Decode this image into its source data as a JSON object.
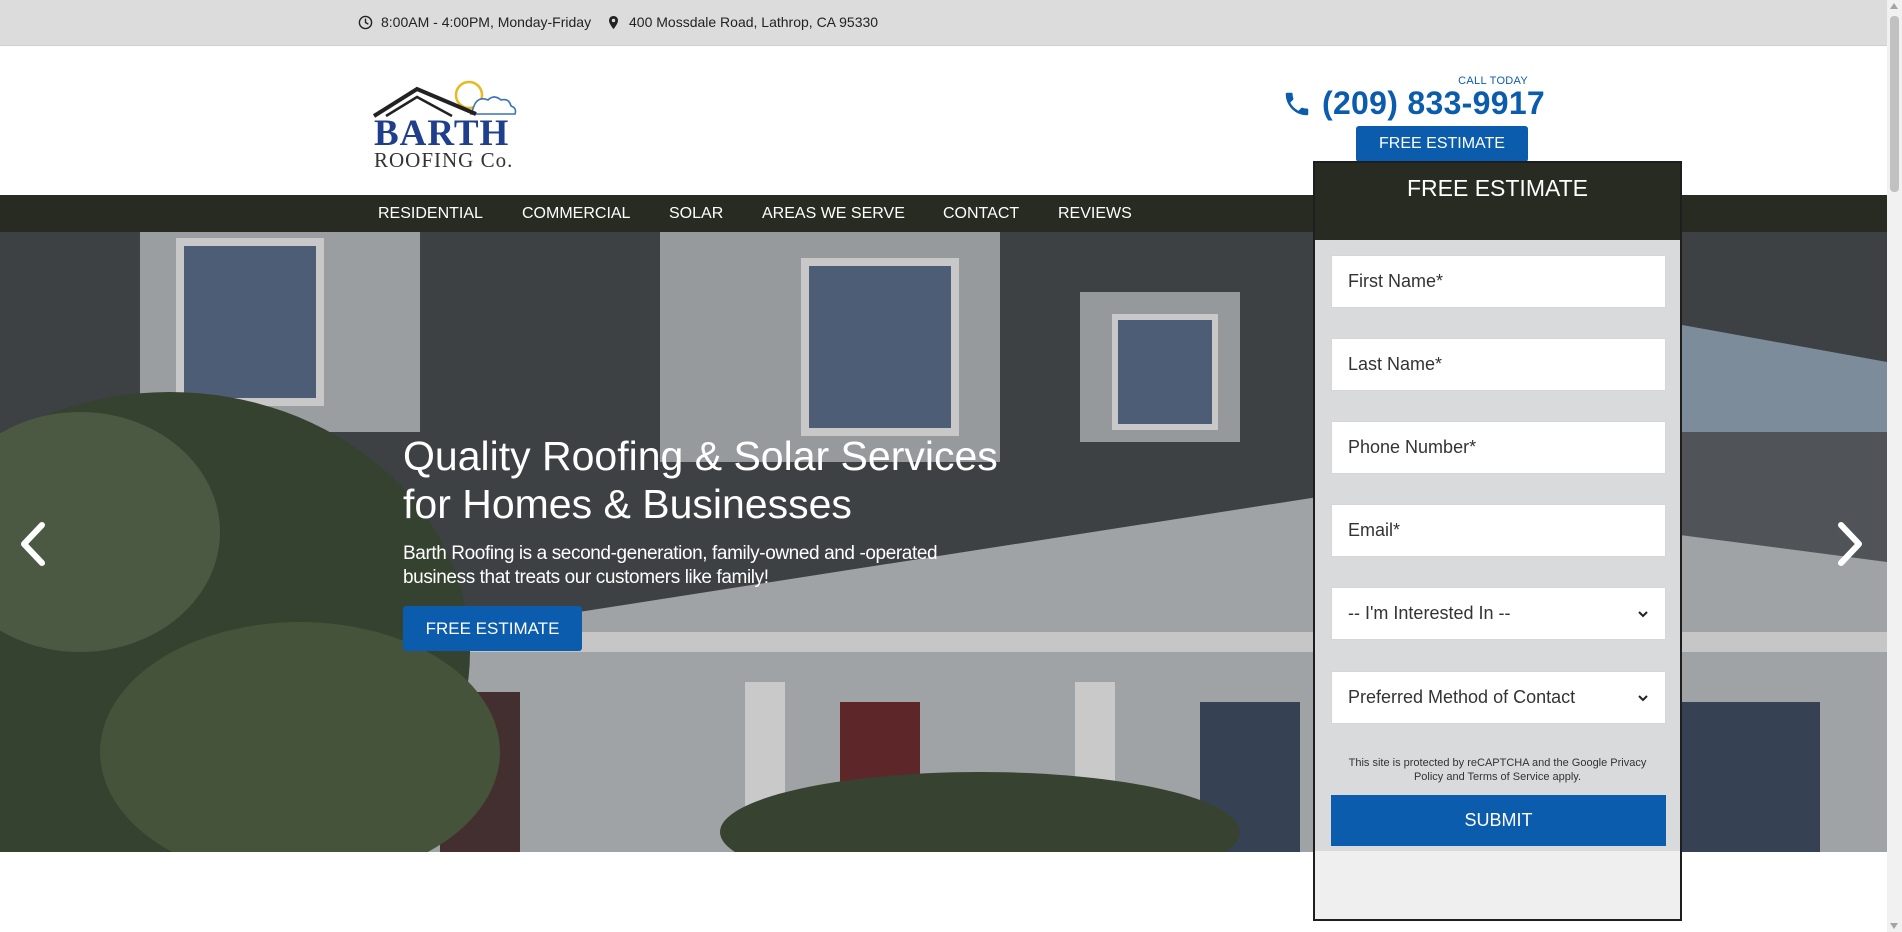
{
  "topbar": {
    "hours": "8:00AM - 4:00PM, Monday-Friday",
    "hours_icon": "clock-icon",
    "address": "400 Mossdale Road, Lathrop, CA 95330",
    "address_icon": "map-pin-icon"
  },
  "header": {
    "logo_line1": "BARTH",
    "logo_line2": "ROOFING Co.",
    "call_today": "CALL TODAY",
    "phone": "(209) 833-9917",
    "phone_icon": "phone-icon",
    "cta": "FREE ESTIMATE"
  },
  "nav": {
    "items": [
      "RESIDENTIAL",
      "COMMERCIAL",
      "SOLAR",
      "AREAS WE SERVE",
      "CONTACT",
      "REVIEWS"
    ]
  },
  "hero": {
    "headline": "Quality Roofing & Solar Services for Homes & Businesses",
    "subtext": "Barth Roofing is a second-generation, family-owned and -operated business that treats our customers like family!",
    "cta": "FREE ESTIMATE",
    "prev_icon": "chevron-left-icon",
    "next_icon": "chevron-right-icon"
  },
  "form": {
    "title": "FREE ESTIMATE",
    "first_name_placeholder": "First Name*",
    "last_name_placeholder": "Last Name*",
    "phone_placeholder": "Phone Number*",
    "email_placeholder": "Email*",
    "interest_select": "-- I'm Interested In --",
    "contact_method_select": "Preferred Method of Contact",
    "recaptcha_text": "This site is protected by reCAPTCHA and the Google Privacy Policy and Terms of Service apply.",
    "submit": "SUBMIT"
  },
  "colors": {
    "brand_blue": "#0b5cad",
    "nav_dark": "#272b21",
    "topbar_gray": "#dcdcdc"
  }
}
